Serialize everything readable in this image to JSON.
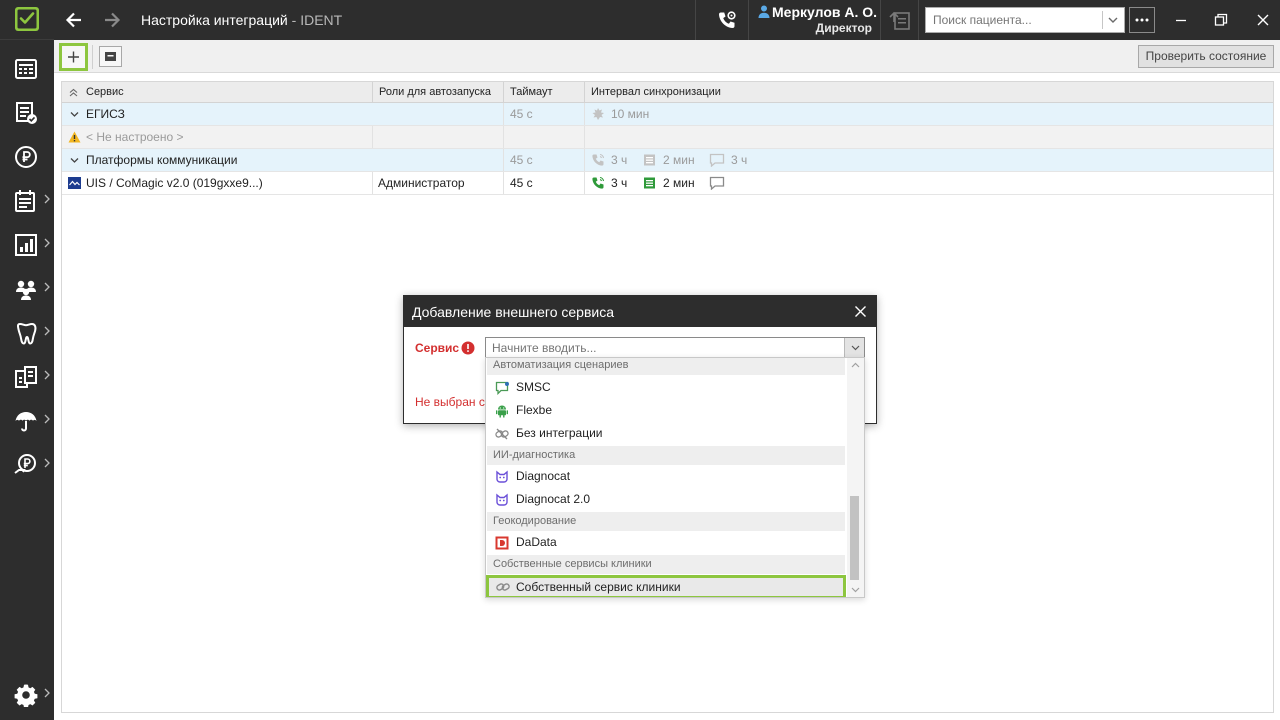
{
  "app": {
    "title": "Настройка интеграций",
    "suffix": " - IDENT"
  },
  "user": {
    "name": "Меркулов А. О.",
    "role": "Директор"
  },
  "search": {
    "placeholder": "Поиск пациента..."
  },
  "toolbar": {
    "check_status_label": "Проверить состояние"
  },
  "table": {
    "columns": [
      "Сервис",
      "Роли для автозапуска",
      "Таймаут",
      "Интервал синхронизации"
    ],
    "rows": [
      {
        "kind": "group",
        "service": "ЕГИСЗ",
        "timeout": "45 с",
        "sync": [
          "10 мин"
        ]
      },
      {
        "kind": "item",
        "service": "< Не настроено >"
      },
      {
        "kind": "group",
        "service": "Платформы коммуникации",
        "timeout": "45 с",
        "sync": [
          "3 ч",
          "2 мин",
          "3 ч"
        ]
      },
      {
        "kind": "item",
        "service": "UIS / CoMagic v2.0 (019gxxe9...)",
        "role": "Администратор",
        "timeout": "45 с",
        "sync": [
          "3 ч",
          "2 мин"
        ]
      }
    ]
  },
  "dialog": {
    "title": "Добавление внешнего сервиса",
    "service_label": "Сервис",
    "service_placeholder": "Начните вводить...",
    "error_text": "Не выбран с"
  },
  "dropdown": {
    "groups": [
      {
        "label": "Автоматизация сценариев",
        "items": [
          {
            "label": "SMSC",
            "icon": "chat-bubble-icon"
          },
          {
            "label": "Flexbe",
            "icon": "android-icon"
          },
          {
            "label": "Без интеграции",
            "icon": "link-off-icon"
          }
        ]
      },
      {
        "label": "ИИ-диагностика",
        "items": [
          {
            "label": "Diagnocat",
            "icon": "diagnocat-icon"
          },
          {
            "label": "Diagnocat 2.0",
            "icon": "diagnocat-icon"
          }
        ]
      },
      {
        "label": "Геокодирование",
        "items": [
          {
            "label": "DaData",
            "icon": "dadata-icon"
          }
        ]
      },
      {
        "label": "Собственные сервисы клиники",
        "items": [
          {
            "label": "Собственный сервис клиники",
            "icon": "link-icon",
            "selected": true
          }
        ]
      }
    ]
  },
  "sidebar": {
    "items": [
      {
        "name": "schedule"
      },
      {
        "name": "journal"
      },
      {
        "name": "finance"
      },
      {
        "name": "reports"
      },
      {
        "name": "analytics"
      },
      {
        "name": "patients"
      },
      {
        "name": "dental"
      },
      {
        "name": "warehouse"
      },
      {
        "name": "insurance"
      },
      {
        "name": "payroll"
      }
    ]
  },
  "colors": {
    "accent": "#8dc63f",
    "dark": "#2d2d2d",
    "error": "#d32f2f",
    "row_group": "#e5f3fb",
    "green_icon": "#3a9d3a",
    "diagnocat": "#6a4fd8"
  }
}
